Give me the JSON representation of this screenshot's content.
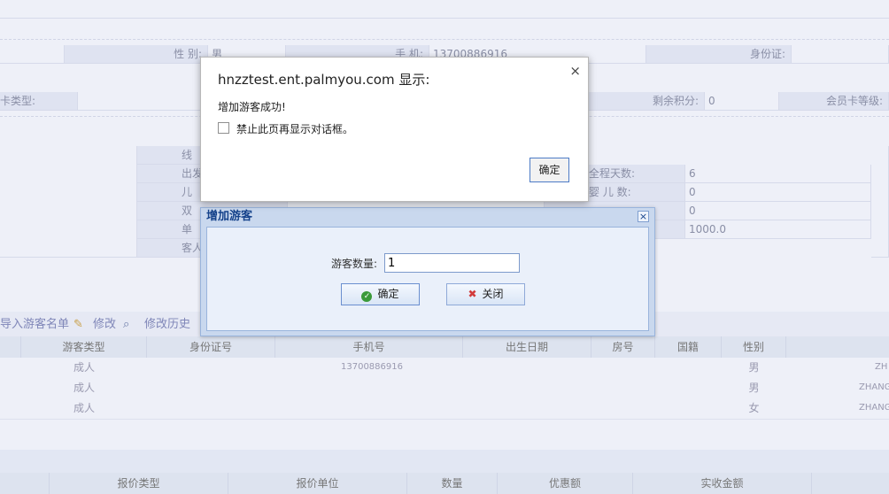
{
  "form": {
    "gender_label": "性 别:",
    "gender_value": "男",
    "phone_label": "手 机:",
    "phone_value": "13700886916",
    "idcard_label": "身份证:",
    "card_type_label": "卡类型:",
    "points_label": "剩余积分:",
    "points_value": "0",
    "member_level_label": "会员卡等级:",
    "line_label": "线",
    "depart_label": "出发",
    "children_label": "儿",
    "double_label": "双",
    "single_label": "单",
    "guest_label": "客人",
    "total_days_label": "全程天数:",
    "total_days_value": "6",
    "infant_label": "婴 儿 数:",
    "infant_value": "0",
    "row3_value": "0",
    "row4_value": "1000.0"
  },
  "toolbar": {
    "import_label": "导入游客名单",
    "edit_label": "修改",
    "history_label": "修改历史"
  },
  "table": {
    "headers": [
      "游客类型",
      "身份证号",
      "手机号",
      "出生日期",
      "房号",
      "国籍",
      "性别"
    ],
    "rows": [
      {
        "type": "成人",
        "phone": "13700886916",
        "gender": "男",
        "name": "ZH"
      },
      {
        "type": "成人",
        "phone": "",
        "gender": "男",
        "name": "ZHANGS"
      },
      {
        "type": "成人",
        "phone": "",
        "gender": "女",
        "name": "ZHANGS"
      }
    ]
  },
  "bottom_headers": [
    "报价类型",
    "报价单位",
    "数量",
    "优惠额",
    "实收金额"
  ],
  "alert": {
    "title": "hnzztest.ent.palmyou.com 显示:",
    "message": "增加游客成功!",
    "checkbox_label": "禁止此页再显示对话框。",
    "ok_label": "确定",
    "close_glyph": "×"
  },
  "dialog": {
    "title": "增加游客",
    "close_glyph": "×",
    "count_label": "游客数量:",
    "count_value": "1",
    "ok_label": "确定",
    "close_label": "关闭"
  }
}
